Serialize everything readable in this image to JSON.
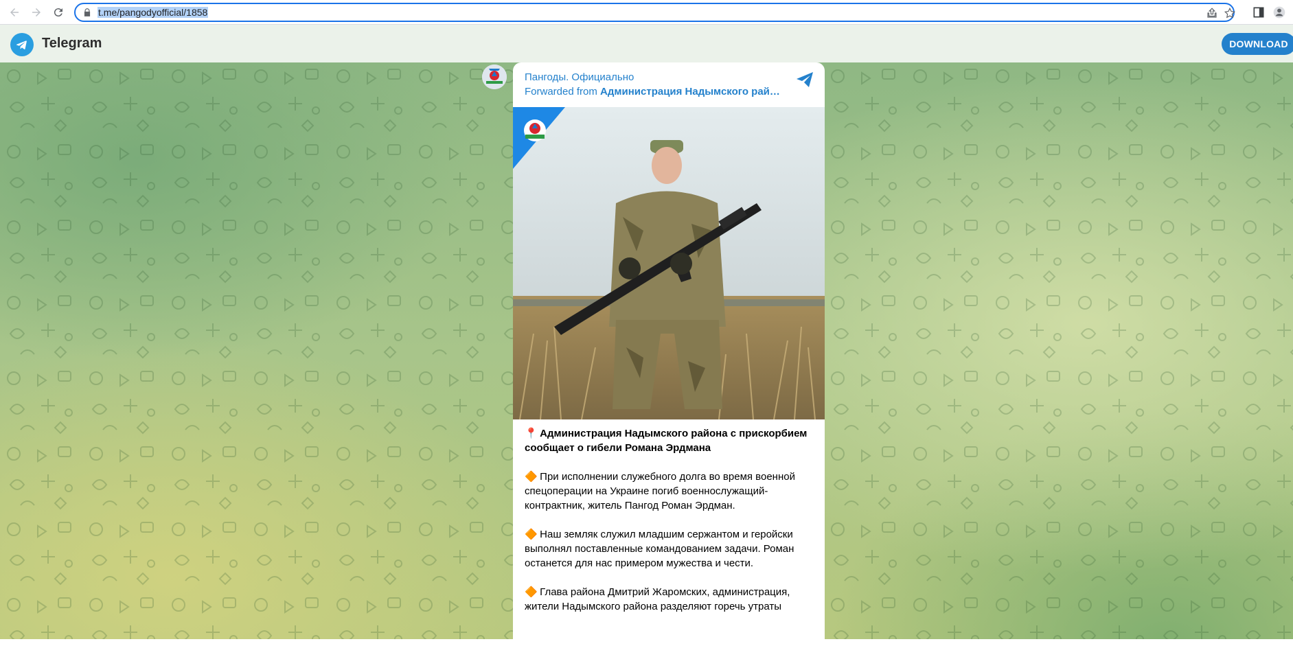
{
  "browser": {
    "url": "t.me/pangodyofficial/1858",
    "icons": [
      "back-arrow-icon",
      "forward-arrow-icon",
      "reload-icon",
      "lock-icon",
      "share-icon",
      "star-icon",
      "side-panel-icon",
      "profile-icon"
    ]
  },
  "header": {
    "brand": "Telegram",
    "download_label": "DOWNLOAD"
  },
  "post": {
    "channel_name": "Пангоды. Официально",
    "forwarded_prefix": "Forwarded from ",
    "forwarded_source": "Администрация Надымского рай…",
    "paragraphs": [
      {
        "emoji": "📍",
        "text": "Администрация Надымского района с прискорбием сообщает о гибели Романа Эрдмана"
      },
      {
        "emoji": "🔶",
        "text": "При исполнении служебного долга во время военной спецоперации на Украине погиб военнослужащий-контрактник, житель Пангод Роман Эрдман."
      },
      {
        "emoji": "🔶",
        "text": "Наш земляк служил младшим сержантом и геройски выполнял поставленные командованием задачи. Роман останется для нас примером мужества и чести."
      },
      {
        "emoji": "🔶",
        "text": "Глава района Дмитрий Жаромских, администрация, жители Надымского района разделяют горечь утраты"
      }
    ]
  },
  "colors": {
    "accent": "#2481cc",
    "header_bg": "#ebf2ea",
    "url_highlight": "#b3d2f7"
  }
}
